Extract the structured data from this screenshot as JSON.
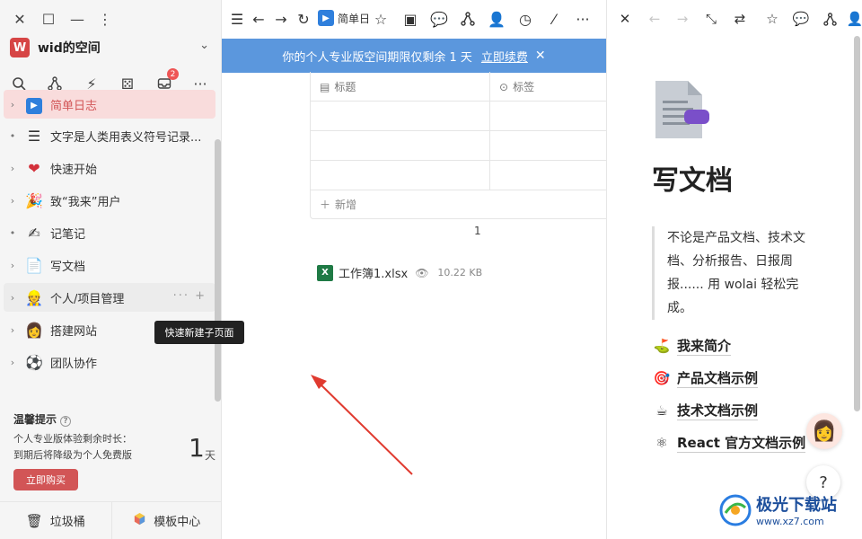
{
  "sidebar": {
    "workspace": {
      "initial": "W",
      "name": "wid的空间"
    },
    "inbox_badge": "2",
    "tree": [
      {
        "label": "简单日志",
        "emoji": "▶",
        "arrow": "›",
        "active": true
      },
      {
        "label": "文字是人类用表义符号记录...",
        "emoji": "☰",
        "arrow": "•"
      },
      {
        "label": "快速开始",
        "emoji": "❤",
        "arrow": "›"
      },
      {
        "label": "致“我来”用户",
        "emoji": "🎉",
        "arrow": "›"
      },
      {
        "label": "记笔记",
        "emoji": "✍",
        "arrow": "•"
      },
      {
        "label": "写文档",
        "emoji": "📄",
        "arrow": "›"
      },
      {
        "label": "个人/项目管理",
        "emoji": "👷",
        "arrow": "›",
        "trail": "··· +"
      },
      {
        "label": "搭建网站",
        "emoji": "👩",
        "arrow": "›"
      },
      {
        "label": "团队协作",
        "emoji": "⚽",
        "arrow": "›"
      }
    ],
    "tip": {
      "title": "温馨提示",
      "line1": "个人专业版体验剩余时长：",
      "line2": "到期后将降级为个人免费版",
      "days": "1",
      "unit": "天",
      "buy": "立即购买"
    },
    "bottom": {
      "trash": "垃圾桶",
      "templates": "模板中心"
    }
  },
  "middle": {
    "page_chip": "简单日",
    "banner": {
      "text": "你的个人专业版空间期限仅剩余 1 天",
      "renew": "立即续费"
    },
    "table": {
      "col_title": "标题",
      "col_tag": "标签",
      "add": "新增"
    },
    "page_num": "1",
    "file": {
      "name": "工作簿1.xlsx",
      "size": "10.22 KB"
    },
    "tooltip": "快速新建子页面"
  },
  "right": {
    "title": "写文档",
    "quote": "不论是产品文档、技术文档、分析报告、日报周报...... 用 wolai 轻松完成。",
    "links": [
      {
        "emoji": "⛳",
        "label": "我来简介"
      },
      {
        "emoji": "🎯",
        "label": "产品文档示例"
      },
      {
        "emoji": "☕",
        "label": "技术文档示例"
      },
      {
        "emoji": "⚛",
        "label": "React 官方文档示例"
      }
    ],
    "help": "?"
  },
  "watermark": {
    "line1": "极光下载站",
    "line2": "www.xz7.com"
  }
}
